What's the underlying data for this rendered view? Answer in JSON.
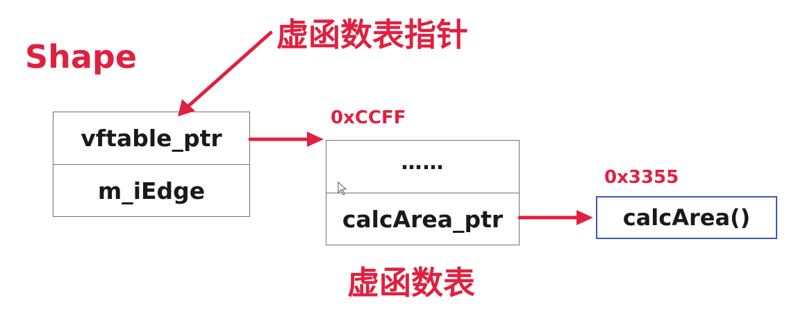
{
  "shape_title": "Shape",
  "vptr_label": "虚函数表指针",
  "vtable_label": "虚函数表",
  "shape_object": {
    "fields": [
      "vftable_ptr",
      "m_iEdge"
    ]
  },
  "vtable": {
    "address": "0xCCFF",
    "entries": [
      "……",
      "calcArea_ptr"
    ]
  },
  "function": {
    "address": "0x3355",
    "name": "calcArea()"
  },
  "colors": {
    "accent_red": "#e0203f",
    "function_border": "#3b5aa8",
    "box_border": "#707070"
  }
}
